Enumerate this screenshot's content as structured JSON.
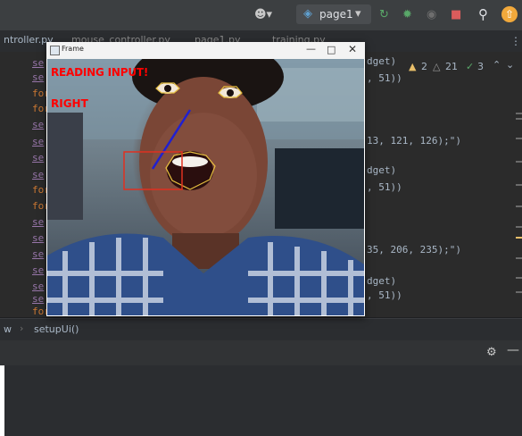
{
  "toolbar": {
    "user_icon": "user-icon",
    "run_config": "page1",
    "search_icon": "search-icon",
    "update_icon": "update-icon"
  },
  "tabs": [
    {
      "label": "ntroller.py"
    },
    {
      "label": "mouse_controller.py"
    },
    {
      "label": "page1.py"
    },
    {
      "label": "training.py"
    }
  ],
  "inspections": {
    "warnings": "2",
    "weak_warnings": "21",
    "ok": "3"
  },
  "code": {
    "l1": "dget)",
    "l2": ", 51))",
    "l3": "13, 121, 126);\")",
    "l4": "dget)",
    "l5": ", 51))",
    "l6": "35, 206, 235);\")",
    "l7": "dget)",
    "l8": ", 51))",
    "se": "se",
    "for": "for"
  },
  "breadcrumb": {
    "left": "w",
    "item": "setupUi()"
  },
  "frame": {
    "title": "Frame",
    "overlay1": "READING INPUT!",
    "overlay2": "RIGHT"
  },
  "colors": {
    "overlay_text": "#ff0000",
    "accent_orange": "#f2a93b"
  }
}
